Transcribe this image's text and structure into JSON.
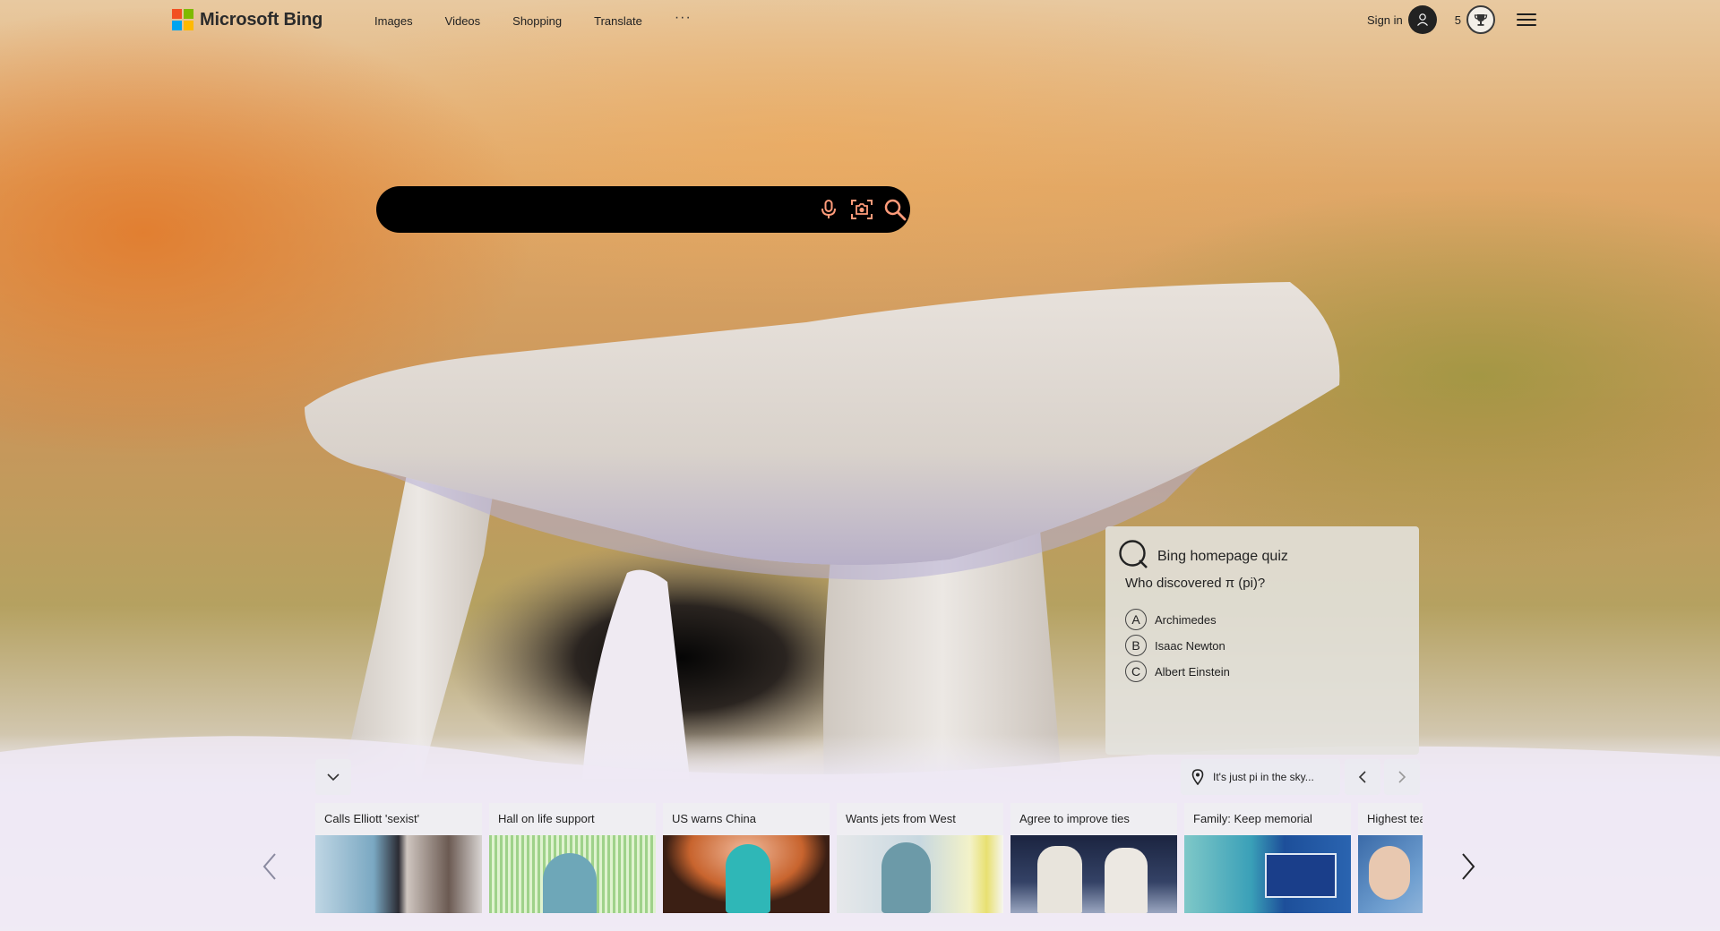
{
  "header": {
    "logo_text": "Microsoft Bing",
    "nav": [
      "Images",
      "Videos",
      "Shopping",
      "Translate"
    ],
    "more_label": "···",
    "sign_in": "Sign in",
    "rewards_count": "5"
  },
  "search": {
    "value": "",
    "placeholder": ""
  },
  "quiz": {
    "title": "Bing homepage quiz",
    "question": "Who discovered π (pi)?",
    "options": [
      {
        "letter": "A",
        "text": "Archimedes"
      },
      {
        "letter": "B",
        "text": "Isaac Newton"
      },
      {
        "letter": "C",
        "text": "Albert Einstein"
      }
    ]
  },
  "image_info": {
    "caption": "It's just pi in the sky..."
  },
  "news": [
    {
      "title": "Calls Elliott 'sexist'"
    },
    {
      "title": "Hall on life support"
    },
    {
      "title": "US warns China"
    },
    {
      "title": "Wants jets from West"
    },
    {
      "title": "Agree to improve ties"
    },
    {
      "title": "Family: Keep memorial"
    },
    {
      "title": "Highest tea"
    }
  ],
  "colors": {
    "logo_red": "#f25022",
    "logo_green": "#7fba00",
    "logo_blue": "#00a4ef",
    "logo_yellow": "#ffb900",
    "search_bg": "#000000",
    "search_icon": "#ff9b7a"
  }
}
